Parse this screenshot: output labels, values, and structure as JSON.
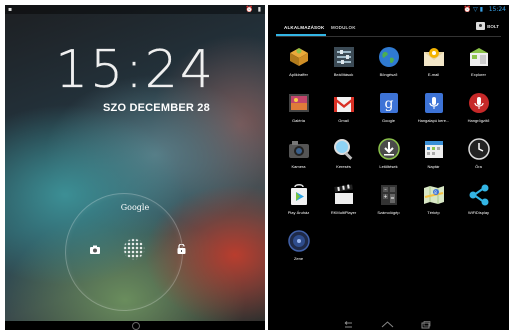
{
  "lock_screen": {
    "time": "15:24",
    "date": "SZO DECEMBER 28",
    "google_label": "Google"
  },
  "drawer": {
    "status_time": "15:24",
    "tabs": [
      {
        "label": "ALKALMAZÁSOK",
        "active": true
      },
      {
        "label": "MODULOK",
        "active": false
      }
    ],
    "store_label": "BOLT",
    "apps": [
      {
        "label": "Aplikiraffer",
        "icon": "package-icon"
      },
      {
        "label": "Beállítások",
        "icon": "settings-icon"
      },
      {
        "label": "Böngésző",
        "icon": "globe-icon"
      },
      {
        "label": "E-mail",
        "icon": "email-icon"
      },
      {
        "label": "Explorer",
        "icon": "explorer-icon"
      },
      {
        "label": "Galéria",
        "icon": "gallery-icon"
      },
      {
        "label": "Gmail",
        "icon": "gmail-icon"
      },
      {
        "label": "Google",
        "icon": "google-icon"
      },
      {
        "label": "Hangalapú kere...",
        "icon": "voice-search-icon"
      },
      {
        "label": "Hangrögzítő",
        "icon": "recorder-icon"
      },
      {
        "label": "Kamera",
        "icon": "camera-icon"
      },
      {
        "label": "Keresés",
        "icon": "search-icon"
      },
      {
        "label": "Letöltések",
        "icon": "download-icon"
      },
      {
        "label": "Naptár",
        "icon": "calendar-icon"
      },
      {
        "label": "Óra",
        "icon": "clock-icon"
      },
      {
        "label": "Play Áruház",
        "icon": "play-store-icon"
      },
      {
        "label": "RKMultiPlayer",
        "icon": "clapper-icon"
      },
      {
        "label": "Számológép",
        "icon": "calculator-icon"
      },
      {
        "label": "Térkép",
        "icon": "maps-icon"
      },
      {
        "label": "WiFiDisplay",
        "icon": "share-icon"
      },
      {
        "label": "Zene",
        "icon": "music-icon"
      }
    ]
  }
}
